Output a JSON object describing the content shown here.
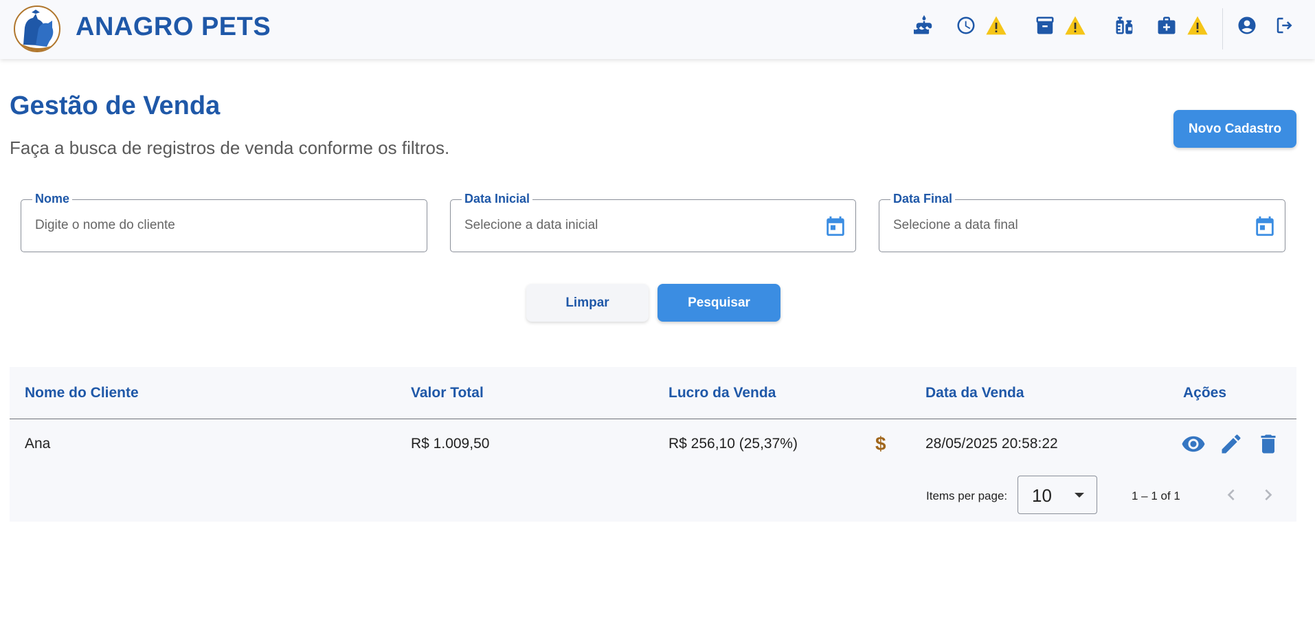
{
  "header": {
    "brand": "ANAGRO PETS",
    "icons": [
      "cake-icon",
      "clock-icon",
      "warning-icon",
      "archive-icon",
      "warning-icon",
      "vaccine-icon",
      "medical-kit-icon",
      "warning-icon",
      "account-icon",
      "logout-icon"
    ]
  },
  "page": {
    "title": "Gestão de Venda",
    "subtitle": "Faça a busca de registros de venda conforme os filtros.",
    "new_button": "Novo Cadastro"
  },
  "filters": {
    "name": {
      "label": "Nome",
      "placeholder": "Digite o nome do cliente"
    },
    "start_date": {
      "label": "Data Inicial",
      "placeholder": "Selecione a data inicial"
    },
    "end_date": {
      "label": "Data Final",
      "placeholder": "Selecione a data final"
    },
    "clear_button": "Limpar",
    "search_button": "Pesquisar"
  },
  "table": {
    "columns": [
      "Nome do Cliente",
      "Valor Total",
      "Lucro da Venda",
      "Data da Venda",
      "Ações"
    ],
    "rows": [
      {
        "client": "Ana",
        "total": "R$ 1.009,50",
        "profit": "R$ 256,10 (25,37%)",
        "profit_icon": "$",
        "date": "28/05/2025 20:58:22"
      }
    ]
  },
  "paginator": {
    "items_per_page_label": "Items per page:",
    "page_size": "10",
    "range": "1 – 1 of 1"
  },
  "colors": {
    "primary": "#1f58a8",
    "button": "#3b8de2",
    "warning": "#f5c518",
    "dollar": "#a0661c"
  }
}
